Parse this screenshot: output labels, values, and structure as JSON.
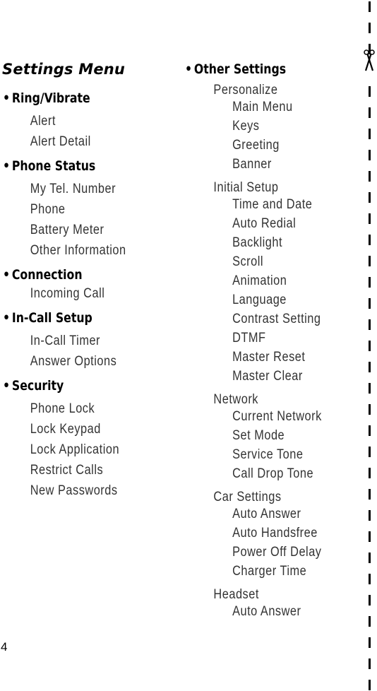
{
  "title": "Settings Menu",
  "page_number": "4",
  "bullet": "•",
  "left_column": [
    {
      "heading": "Ring/Vibrate",
      "items": [
        "Alert",
        "Alert Detail"
      ]
    },
    {
      "heading": "Phone Status",
      "items": [
        "My Tel. Number",
        "Phone",
        "Battery Meter",
        "Other Information"
      ]
    },
    {
      "heading": "Connection",
      "items": [
        "Incoming Call"
      ]
    },
    {
      "heading": "In-Call Setup",
      "items": [
        "In-Call Timer",
        "Answer Options"
      ]
    },
    {
      "heading": "Security",
      "items": [
        "Phone Lock",
        "Lock Keypad",
        "Lock Application",
        "Restrict Calls",
        "New Passwords"
      ]
    }
  ],
  "right_column": {
    "heading": "Other Settings",
    "groups": [
      {
        "label": "Personalize",
        "items": [
          "Main Menu",
          "Keys",
          "Greeting",
          "Banner"
        ]
      },
      {
        "label": "Initial Setup",
        "items": [
          "Time and Date",
          "Auto Redial",
          "Backlight",
          "Scroll",
          "Animation",
          "Language",
          "Contrast Setting",
          "DTMF",
          "Master Reset",
          "Master Clear"
        ]
      },
      {
        "label": "Network",
        "items": [
          "Current Network",
          "Set Mode",
          "Service Tone",
          "Call Drop Tone"
        ]
      },
      {
        "label": "Car Settings",
        "items": [
          "Auto Answer",
          "Auto Handsfree",
          "Power Off Delay",
          "Charger Time"
        ]
      },
      {
        "label": "Headset",
        "items": [
          "Auto Answer"
        ]
      }
    ]
  },
  "icons": {
    "cut_marker": "scissors-icon"
  }
}
